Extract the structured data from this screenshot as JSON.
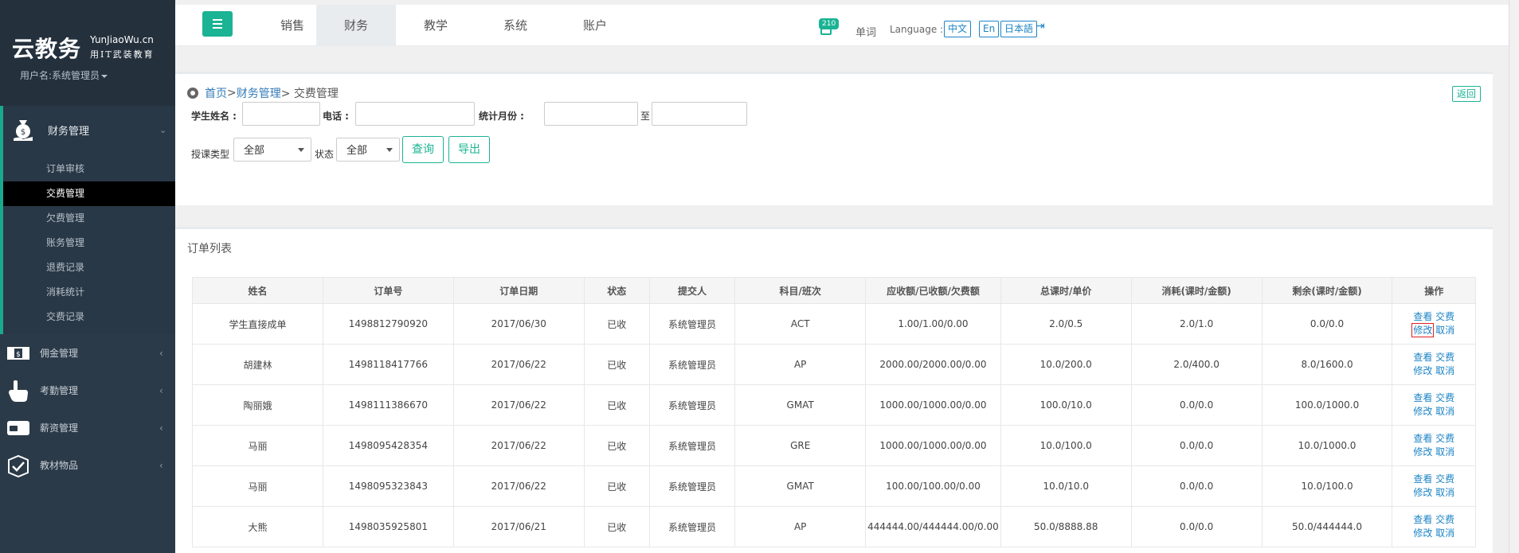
{
  "brand": {
    "name_cn": "云教务",
    "name_en": "YunJiaoWu.cn",
    "slogan": "用IT武装教育",
    "user": "用户名:系统管理员"
  },
  "sidebar": {
    "finance": {
      "label": "财务管理",
      "items": [
        "订单审核",
        "交费管理",
        "欠费管理",
        "账务管理",
        "退费记录",
        "消耗统计",
        "交费记录"
      ],
      "active_index": 1
    },
    "others": [
      "佣金管理",
      "考勤管理",
      "薪资管理",
      "教材物品"
    ]
  },
  "topnav": {
    "tabs": [
      "销售",
      "财务",
      "教学",
      "系统",
      "账户"
    ],
    "active_index": 1,
    "badge": "210",
    "word": "单词",
    "language_label": "Language :",
    "languages": [
      "中文",
      "En",
      "日本語"
    ]
  },
  "breadcrumb": {
    "home": "首页",
    "sep1": " >",
    "section": "财务管理",
    "current": "> 交费管理",
    "back": "返回"
  },
  "filters": {
    "student_name_label": "学生姓名 :",
    "phone_label": "电话 :",
    "month_label": "统计月份 :",
    "to_label": "至",
    "course_type_label": "授课类型",
    "course_type_value": "全部",
    "status_label": "状态",
    "status_value": "全部",
    "query": "查询",
    "export": "导出"
  },
  "list": {
    "title": "订单列表",
    "columns": [
      "姓名",
      "订单号",
      "订单日期",
      "状态",
      "提交人",
      "科目/班次",
      "应收额/已收额/欠费额",
      "总课时/单价",
      "消耗(课时/金额)",
      "剩余(课时/金额)",
      "操作"
    ],
    "rows": [
      [
        "学生直接成单",
        "1498812790920",
        "2017/06/30",
        "已收",
        "系统管理员",
        "ACT",
        "1.00/1.00/0.00",
        "2.0/0.5",
        "2.0/1.0",
        "0.0/0.0"
      ],
      [
        "胡建林",
        "1498118417766",
        "2017/06/22",
        "已收",
        "系统管理员",
        "AP",
        "2000.00/2000.00/0.00",
        "10.0/200.0",
        "2.0/400.0",
        "8.0/1600.0"
      ],
      [
        "陶丽娥",
        "1498111386670",
        "2017/06/22",
        "已收",
        "系统管理员",
        "GMAT",
        "1000.00/1000.00/0.00",
        "100.0/10.0",
        "0.0/0.0",
        "100.0/1000.0"
      ],
      [
        "马丽",
        "1498095428354",
        "2017/06/22",
        "已收",
        "系统管理员",
        "GRE",
        "1000.00/1000.00/0.00",
        "10.0/100.0",
        "0.0/0.0",
        "10.0/1000.0"
      ],
      [
        "马丽",
        "1498095323843",
        "2017/06/22",
        "已收",
        "系统管理员",
        "GMAT",
        "100.00/100.00/0.00",
        "10.0/10.0",
        "0.0/0.0",
        "10.0/100.0"
      ],
      [
        "大熊",
        "1498035925801",
        "2017/06/21",
        "已收",
        "系统管理员",
        "AP",
        "444444.00/444444.00/0.00",
        "50.0/8888.88",
        "0.0/0.0",
        "50.0/444444.0"
      ]
    ],
    "ops": {
      "view": "查看",
      "pay": "交费",
      "edit": "修改",
      "cancel": "取消"
    }
  },
  "colors": {
    "accent": "#1ab394",
    "link": "#1c84c6",
    "sidebar_bg": "#2b3a48",
    "highlight": "#e02020"
  }
}
